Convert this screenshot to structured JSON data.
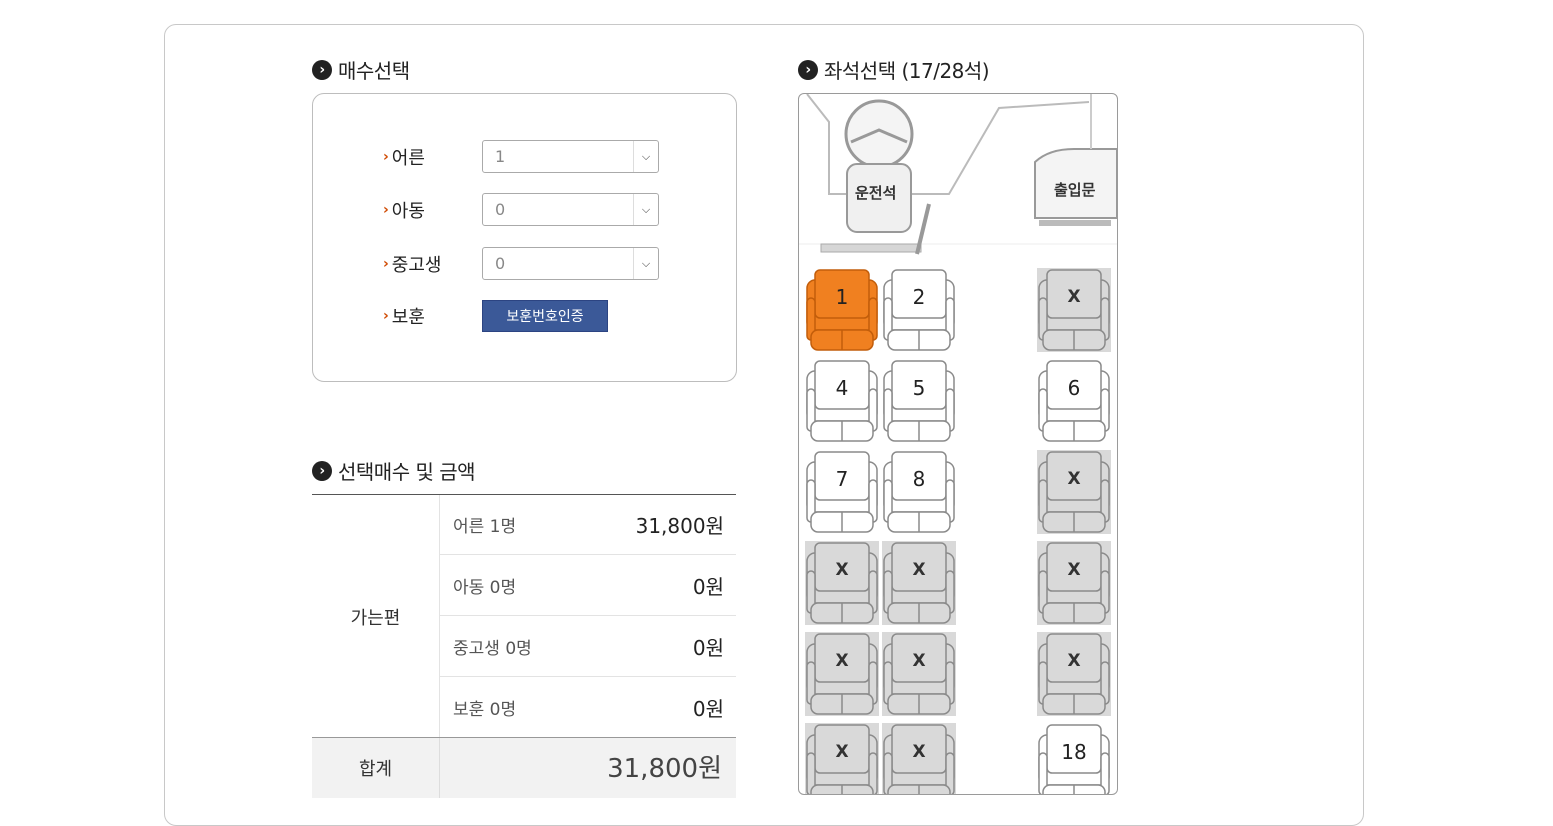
{
  "quantity": {
    "title": "매수선택",
    "rows": [
      {
        "label": "어른",
        "value": "1"
      },
      {
        "label": "아동",
        "value": "0"
      },
      {
        "label": "중고생",
        "value": "0"
      }
    ],
    "veteran": {
      "label": "보훈",
      "button": "보훈번호인증"
    }
  },
  "summary": {
    "title": "선택매수 및 금액",
    "trip_label": "가는편",
    "rows": [
      {
        "label": "어른 1명",
        "amount": "31,800원"
      },
      {
        "label": "아동 0명",
        "amount": "0원"
      },
      {
        "label": "중고생 0명",
        "amount": "0원"
      },
      {
        "label": "보훈 0명",
        "amount": "0원"
      }
    ],
    "total_label": "합계",
    "total_amount": "31,800원"
  },
  "seat_map": {
    "title": "좌석선택 (17/28석)",
    "driver_label": "운전석",
    "door_label": "출입문",
    "seats": [
      {
        "label": "1",
        "state": "selected"
      },
      {
        "label": "2",
        "state": "available"
      },
      {
        "label": "X",
        "state": "unavailable"
      },
      {
        "label": "4",
        "state": "available"
      },
      {
        "label": "5",
        "state": "available"
      },
      {
        "label": "6",
        "state": "available"
      },
      {
        "label": "7",
        "state": "available"
      },
      {
        "label": "8",
        "state": "available"
      },
      {
        "label": "X",
        "state": "unavailable"
      },
      {
        "label": "X",
        "state": "unavailable"
      },
      {
        "label": "X",
        "state": "unavailable"
      },
      {
        "label": "X",
        "state": "unavailable"
      },
      {
        "label": "X",
        "state": "unavailable"
      },
      {
        "label": "X",
        "state": "unavailable"
      },
      {
        "label": "X",
        "state": "unavailable"
      },
      {
        "label": "X",
        "state": "unavailable"
      },
      {
        "label": "X",
        "state": "unavailable"
      },
      {
        "label": "18",
        "state": "available"
      }
    ]
  },
  "colors": {
    "selected": "#f08020",
    "unavailable_bg": "#d9d9d9",
    "button": "#3b5998",
    "accent_chevron": "#d04a02"
  },
  "icons": {
    "section_bullet": "chevron-right-circle-icon",
    "select_arrow": "chevron-down-icon",
    "label_marker": "chevron-right-icon"
  }
}
